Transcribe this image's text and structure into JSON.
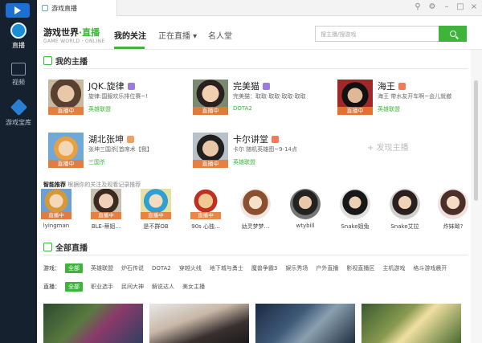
{
  "app": {
    "tab_title": "游戏直播"
  },
  "sidebar": {
    "items": [
      {
        "label": "直播",
        "icon": "live-icon"
      },
      {
        "label": "视频",
        "icon": "video-icon"
      },
      {
        "label": "游戏宝库",
        "icon": "game-library-icon"
      }
    ]
  },
  "header": {
    "brand_main": "游戏世界",
    "brand_accent": "·直播",
    "brand_sub": "GAME WORLD · ONLINE",
    "nav": [
      {
        "label": "我的关注",
        "active": true
      },
      {
        "label": "正在直播 ▾",
        "active": false
      },
      {
        "label": "名人堂",
        "active": false
      }
    ],
    "search_placeholder": "搜主播/搜游戏"
  },
  "my_anchors": {
    "title": "我的主播",
    "live_tag": "直播中",
    "items": [
      {
        "name": "JQK.旋律",
        "desc": "旋律:国服欢乐排位赛~!",
        "game": "英雄联盟",
        "badge": "#9b7be0"
      },
      {
        "name": "完美猫",
        "desc": "完美猫：取取·取取·取取·取取",
        "game": "DOTA2",
        "badge": "#9b7be0"
      },
      {
        "name": "海王",
        "desc": "海王 带水友开车啊~会儿就撤",
        "game": "英雄联盟",
        "badge": "#f07a5a"
      },
      {
        "name": "湖北张坤",
        "desc": "张坤三国杀[首席术【我】",
        "game": "三国杀",
        "badge": "#f0a060"
      },
      {
        "name": "卡尔讲堂",
        "desc": "卡尔 随机英雄图~9-14点",
        "game": "英雄联盟",
        "badge": "#f07a5a"
      }
    ],
    "discover_label": "+ 发现主播"
  },
  "recommend": {
    "title": "智能推荐",
    "subtitle": "根据你的关注及观看记录推荐",
    "live_tag": "直播中",
    "items": [
      {
        "name": "lyingman",
        "live": true
      },
      {
        "name": "BLE-蒂姐...",
        "live": true
      },
      {
        "name": "是不群OB",
        "live": true
      },
      {
        "name": "90s 心独...",
        "live": true
      },
      {
        "name": "幼灵梦梦...",
        "live": false
      },
      {
        "name": "wtybill",
        "live": false
      },
      {
        "name": "Snake姐兔",
        "live": false
      },
      {
        "name": "Snake艾拉",
        "live": false
      },
      {
        "name": "炸妹呦?",
        "live": false
      }
    ]
  },
  "all_live": {
    "title": "全部直播",
    "game_filter_label": "游戏：",
    "game_filters": [
      "全部",
      "英雄联盟",
      "炉石传说",
      "DOTA2",
      "穿越火线",
      "地下城与勇士",
      "魔兽争霸3",
      "娱乐秀场",
      "户外直播",
      "影视直播区",
      "主机游戏",
      "格斗游戏晨开"
    ],
    "live_filter_label": "直播：",
    "live_filters": [
      "全部",
      "职业选手",
      "民间大神",
      "解说达人",
      "美女主播"
    ]
  },
  "colors": {
    "accent": "#3eb53a",
    "sidebar": "#15212e",
    "live": "#eb7832"
  }
}
